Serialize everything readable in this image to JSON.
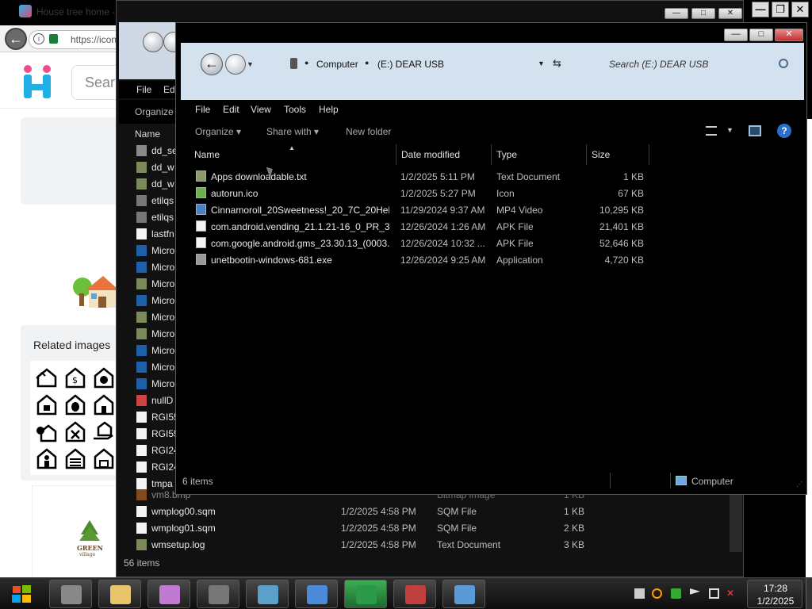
{
  "browser": {
    "tab_title": "House tree home -",
    "url": "https://icon",
    "search_placeholder": "Sear",
    "related_title": "Related images",
    "green_village_text": "GREEN village"
  },
  "window_back": {
    "menu": [
      "File",
      "Ed"
    ],
    "organize": "Organize",
    "column_name": "Name",
    "items_partial": [
      {
        "name": "dd_se",
        "icon": "file-icon"
      },
      {
        "name": "dd_w",
        "icon": "log-file-icon"
      },
      {
        "name": "dd_w",
        "icon": "log-file-icon"
      },
      {
        "name": "etilqs",
        "icon": "generic-file-icon"
      },
      {
        "name": "etilqs",
        "icon": "generic-file-icon"
      },
      {
        "name": "lastfn",
        "icon": "blank-file-icon"
      },
      {
        "name": "Micro",
        "icon": "ms-file-icon"
      },
      {
        "name": "Micro",
        "icon": "ms-file-icon"
      },
      {
        "name": "Micro",
        "icon": "log-file-icon"
      },
      {
        "name": "Micro",
        "icon": "ms-file-icon"
      },
      {
        "name": "Micro",
        "icon": "log-file-icon"
      },
      {
        "name": "Micro",
        "icon": "log-file-icon"
      },
      {
        "name": "Micro",
        "icon": "ms-file-icon"
      },
      {
        "name": "Micro",
        "icon": "ms-file-icon"
      },
      {
        "name": "Micro",
        "icon": "ms-file-icon"
      },
      {
        "name": "nullD",
        "icon": "image-file-icon"
      },
      {
        "name": "RGI55",
        "icon": "blank-file-icon"
      },
      {
        "name": "RGI55",
        "icon": "blank-file-icon"
      },
      {
        "name": "RGI24",
        "icon": "blank-file-icon"
      },
      {
        "name": "RGI24",
        "icon": "blank-file-icon"
      },
      {
        "name": "tmpa",
        "icon": "blank-file-icon"
      }
    ],
    "items_full": [
      {
        "name": "vm8.bmp",
        "date": "",
        "type": "Bitmap image",
        "size": "1 KB",
        "icon": "bitmap-file-icon"
      },
      {
        "name": "wmplog00.sqm",
        "date": "1/2/2025 4:58 PM",
        "type": "SQM File",
        "size": "1 KB",
        "icon": "blank-file-icon"
      },
      {
        "name": "wmplog01.sqm",
        "date": "1/2/2025 4:58 PM",
        "type": "SQM File",
        "size": "2 KB",
        "icon": "blank-file-icon"
      },
      {
        "name": "wmsetup.log",
        "date": "1/2/2025 4:58 PM",
        "type": "Text Document",
        "size": "3 KB",
        "icon": "log-file-icon"
      }
    ],
    "status": "56 items",
    "controls": {
      "minimize": "—",
      "maximize": "□",
      "close": "✕"
    }
  },
  "window_front": {
    "breadcrumb": [
      "Computer",
      "(E:) DEAR USB"
    ],
    "search_placeholder": "Search (E:) DEAR USB",
    "menu": [
      "File",
      "Edit",
      "View",
      "Tools",
      "Help"
    ],
    "commands": {
      "organize": "Organize ▾",
      "share_with": "Share with ▾",
      "new_folder": "New folder"
    },
    "columns": {
      "name": "Name",
      "date": "Date modified",
      "type": "Type",
      "size": "Size"
    },
    "files": [
      {
        "name": "Apps downloadable.txt",
        "date": "1/2/2025 5:11 PM",
        "type": "Text Document",
        "size": "1 KB",
        "icon": "text-file-icon"
      },
      {
        "name": "autorun.ico",
        "date": "1/2/2025 5:27 PM",
        "type": "Icon",
        "size": "67 KB",
        "icon": "ico-file-icon"
      },
      {
        "name": "Cinnamoroll_20Sweetness!_20_7C_20Hell...",
        "date": "11/29/2024 9:37 AM",
        "type": "MP4 Video",
        "size": "10,295 KB",
        "icon": "video-file-icon"
      },
      {
        "name": "com.android.vending_21.1.21-16_0_PR_3...",
        "date": "12/26/2024 1:26 AM",
        "type": "APK File",
        "size": "21,401 KB",
        "icon": "blank-file-icon"
      },
      {
        "name": "com.google.android.gms_23.30.13_(0003...",
        "date": "12/26/2024 10:32 ...",
        "type": "APK File",
        "size": "52,646 KB",
        "icon": "blank-file-icon"
      },
      {
        "name": "unetbootin-windows-681.exe",
        "date": "12/26/2024 9:25 AM",
        "type": "Application",
        "size": "4,720 KB",
        "icon": "exe-file-icon"
      }
    ],
    "status_count": "6 items",
    "status_location": "Computer",
    "controls": {
      "minimize": "—",
      "maximize": "□",
      "close": "✕"
    }
  },
  "os_controls": {
    "minimize": "—",
    "maximize": "❐",
    "close": "✕"
  },
  "taskbar": {
    "items": [
      "explorer-task-icon",
      "folder-task-icon",
      "anime-app-task-icon",
      "drive-task-icon",
      "notepad-task-icon",
      "chrome-task-icon",
      "green-app-task-icon",
      "winrar-task-icon",
      "picture-viewer-task-icon"
    ],
    "time": "17:28",
    "date": "1/2/2025"
  }
}
